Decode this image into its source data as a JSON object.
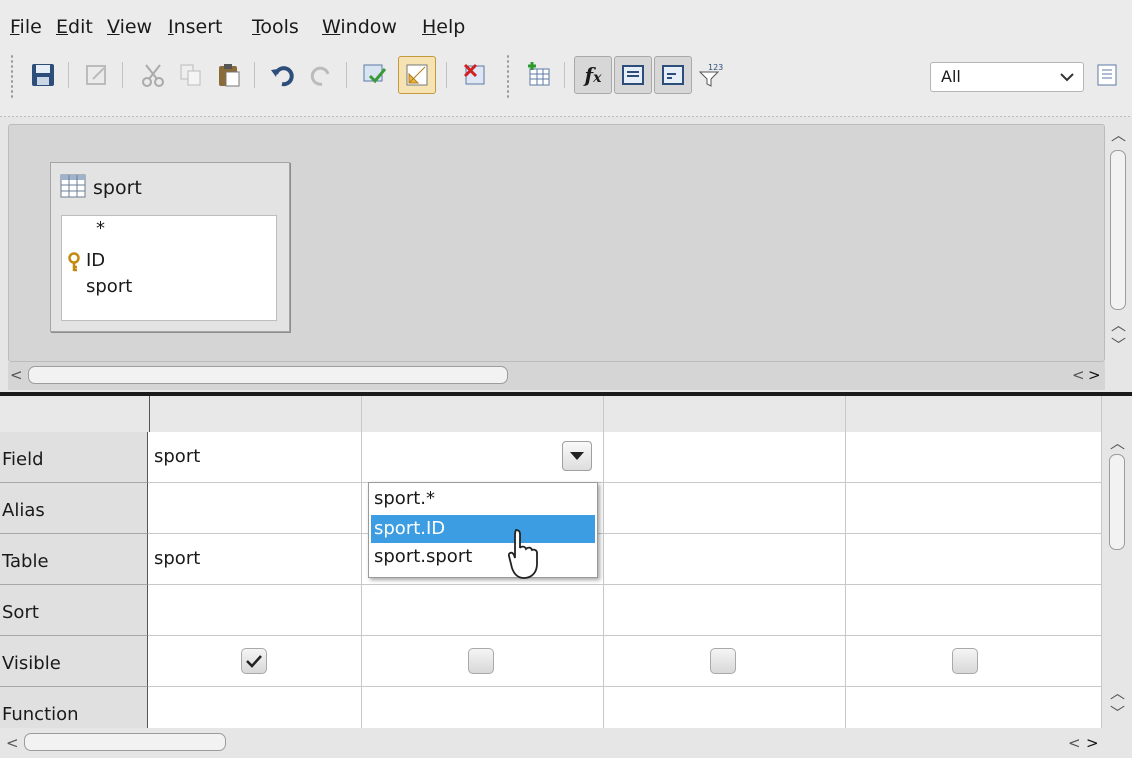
{
  "menu": [
    "File",
    "Edit",
    "View",
    "Insert",
    "Tools",
    "Window",
    "Help"
  ],
  "menu_underline": [
    "F",
    "E",
    "V",
    "I",
    "T",
    "W",
    "H"
  ],
  "toolbar": {
    "limit_select_value": "All"
  },
  "design": {
    "table": {
      "title": "sport",
      "fields": [
        "*",
        "ID",
        "sport"
      ]
    }
  },
  "grid": {
    "row_labels": [
      "Field",
      "Alias",
      "Table",
      "Sort",
      "Visible",
      "Function"
    ],
    "columns": [
      {
        "field": "sport",
        "alias": "",
        "table": "sport",
        "sort": "",
        "visible": true
      },
      {
        "field": "",
        "alias": "",
        "table": "",
        "sort": "",
        "visible": false
      },
      {
        "field": "",
        "alias": "",
        "table": "",
        "sort": "",
        "visible": false
      },
      {
        "field": "",
        "alias": "",
        "table": "",
        "sort": "",
        "visible": false
      }
    ]
  },
  "dropdown": {
    "options": [
      "sport.*",
      "sport.ID",
      "sport.sport"
    ],
    "selected_index": 1
  },
  "colors": {
    "selection": "#3d9de2",
    "background": "#e6e6e6"
  }
}
